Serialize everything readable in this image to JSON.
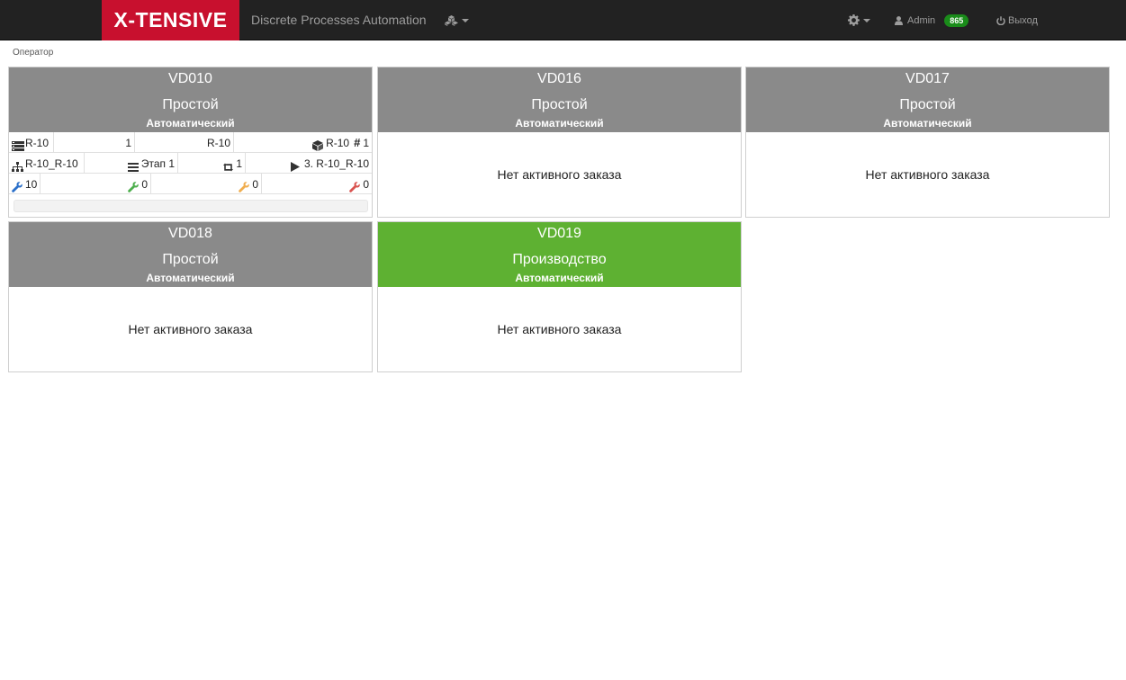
{
  "navbar": {
    "brand": "X-TENSIVE",
    "app_title": "Discrete Processes Automation",
    "user": "Admin",
    "badge": "865",
    "logout": "Выход"
  },
  "breadcrumb": "Оператор",
  "cards": [
    {
      "name": "VD010",
      "state": "Простой",
      "mode": "Автоматический",
      "details": {
        "row1": {
          "product": "R-10",
          "qty": "1",
          "item": "R-10",
          "package": "R-10",
          "count": "1"
        },
        "row2": {
          "route": "R-10_R-10",
          "stage": "Этап 1",
          "cycle": "1",
          "step": "3. R-10_R-10"
        },
        "row3": {
          "tools_blue": "10",
          "tools_green": "0",
          "tools_orange": "0",
          "tools_red": "0"
        }
      }
    },
    {
      "name": "VD016",
      "state": "Простой",
      "mode": "Автоматический",
      "empty": "Нет активного заказа"
    },
    {
      "name": "VD017",
      "state": "Простой",
      "mode": "Автоматический",
      "empty": "Нет активного заказа"
    },
    {
      "name": "VD018",
      "state": "Простой",
      "mode": "Автоматический",
      "empty": "Нет активного заказа"
    },
    {
      "name": "VD019",
      "state": "Производство",
      "mode": "Автоматический",
      "empty": "Нет активного заказа"
    }
  ],
  "colors": {
    "brand": "#c8102e",
    "idle": "#8a8a8a",
    "production": "#5eb132",
    "badge": "#1a8c1a",
    "tool_blue": "#2a6fc9",
    "tool_green": "#4cae4c",
    "tool_orange": "#f0ad4e",
    "tool_red": "#d9534f"
  }
}
